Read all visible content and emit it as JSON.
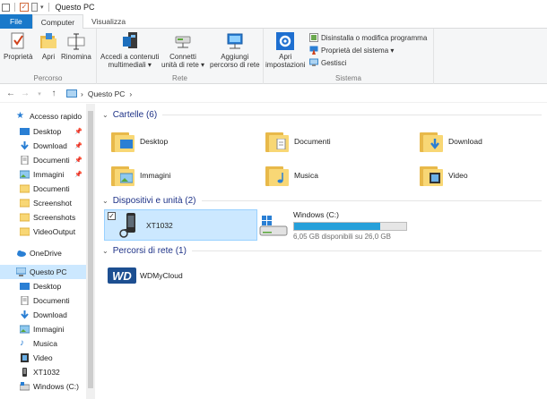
{
  "window": {
    "title": "Questo PC"
  },
  "tabs": [
    {
      "label": "File"
    },
    {
      "label": "Computer"
    },
    {
      "label": "Visualizza"
    }
  ],
  "ribbon": {
    "percorso": {
      "label": "Percorso",
      "proprieta": "Proprietà",
      "apri": "Apri",
      "rinomina": "Rinomina"
    },
    "rete": {
      "label": "Rete",
      "accedi_line1": "Accedi a contenuti",
      "accedi_line2": "multimediali",
      "connetti_line1": "Connetti",
      "connetti_line2": "unità di rete",
      "aggiungi_line1": "Aggiungi",
      "aggiungi_line2": "percorso di rete"
    },
    "sistema": {
      "label": "Sistema",
      "apri_line1": "Apri",
      "apri_line2": "impostazioni",
      "disinstalla": "Disinstalla o modifica programma",
      "proprieta_sistema": "Proprietà del sistema",
      "gestisci": "Gestisci"
    }
  },
  "address": {
    "crumb": "Questo PC"
  },
  "sidebar": {
    "items": [
      {
        "label": "Accesso rapido"
      },
      {
        "label": "Desktop"
      },
      {
        "label": "Download"
      },
      {
        "label": "Documenti"
      },
      {
        "label": "Immagini"
      },
      {
        "label": "Documenti"
      },
      {
        "label": "Screenshot"
      },
      {
        "label": "Screenshots"
      },
      {
        "label": "VideoOutput"
      },
      {
        "label": "OneDrive"
      },
      {
        "label": "Questo PC"
      },
      {
        "label": "Desktop"
      },
      {
        "label": "Documenti"
      },
      {
        "label": "Download"
      },
      {
        "label": "Immagini"
      },
      {
        "label": "Musica"
      },
      {
        "label": "Video"
      },
      {
        "label": "XT1032"
      },
      {
        "label": "Windows (C:)"
      }
    ]
  },
  "main": {
    "cartelle": {
      "header": "Cartelle (6)",
      "items": [
        {
          "label": "Desktop"
        },
        {
          "label": "Documenti"
        },
        {
          "label": "Download"
        },
        {
          "label": "Immagini"
        },
        {
          "label": "Musica"
        },
        {
          "label": "Video"
        }
      ]
    },
    "dispositivi": {
      "header": "Dispositivi e unità (2)",
      "phone": {
        "label": "XT1032"
      },
      "drive": {
        "label": "Windows (C:)",
        "free_text": "6,05 GB disponibili su 26,0 GB",
        "used_fraction": 0.767
      }
    },
    "rete": {
      "header": "Percorsi di rete (1)",
      "item": {
        "label": "WDMyCloud"
      }
    }
  },
  "colors": {
    "accent": "#1979ca",
    "selection": "#cce8ff",
    "folder": "#f8d775",
    "bar_fill": "#26a0da",
    "header_text": "#1e3287"
  }
}
